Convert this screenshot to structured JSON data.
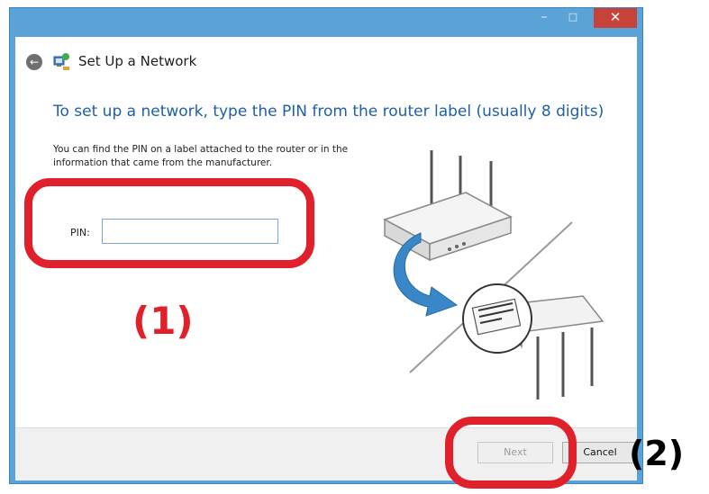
{
  "window": {
    "title": "Set Up a Network",
    "controls": {
      "minimize": "–",
      "maximize": "□",
      "close": "✕"
    }
  },
  "header": {
    "title": "Set Up a Network"
  },
  "content": {
    "instruction": "To set up a network, type the PIN from the router label (usually 8 digits)",
    "description": "You can find the PIN on a label attached to the router or in the information that came from the manufacturer.",
    "pin": {
      "label": "PIN:",
      "value": ""
    }
  },
  "footer": {
    "next_label": "Next",
    "cancel_label": "Cancel"
  },
  "annotations": {
    "step1": "(1)",
    "step2": "(2)"
  },
  "colors": {
    "frame": "#5ba3d6",
    "instruction_text": "#1f5fa8",
    "annotation_red": "#e0202a",
    "close_button": "#c7433a"
  },
  "icons": [
    "back-arrow-icon",
    "network-wizard-icon",
    "router-illustration",
    "curved-arrow-icon"
  ]
}
